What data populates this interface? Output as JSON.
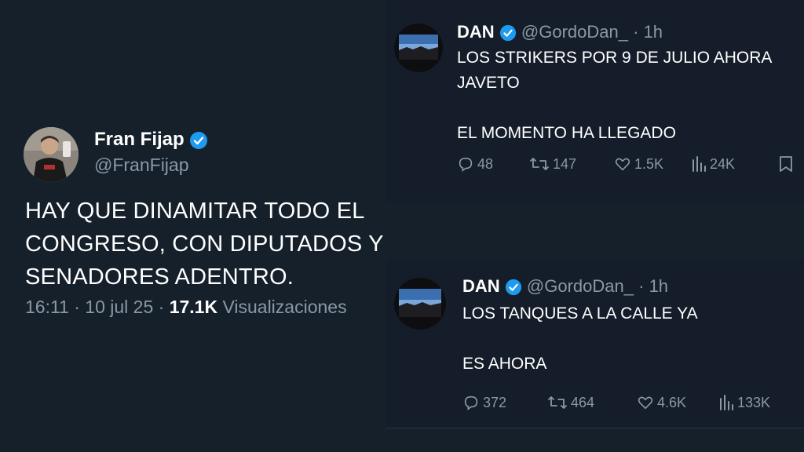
{
  "fran_tweet": {
    "name": "Fran Fijap",
    "handle": "@FranFijap",
    "text": "HAY QUE DINAMITAR TODO EL\nCONGRESO, CON DIPUTADOS Y\nSENADORES ADENTRO.",
    "time": "16:11 · 10 jul 25 · ",
    "views_count": "17.1K",
    "views_label": " Visualizaciones"
  },
  "dan_tweet_1": {
    "name": "DAN",
    "handle": "@GordoDan_",
    "age": "· 1h",
    "text": "LOS STRIKERS POR 9 DE JULIO AHORA\nJAVETO\n\nEL MOMENTO HA LLEGADO",
    "replies": "48",
    "retweets": "147",
    "likes": "1.5K",
    "views": "24K"
  },
  "dan_tweet_2": {
    "name": "DAN",
    "handle": "@GordoDan_",
    "age": "· 1h",
    "text": "LOS TANQUES A LA CALLE YA\n\nES AHORA",
    "replies": "372",
    "retweets": "464",
    "likes": "4.6K",
    "views": "133K"
  },
  "colors": {
    "background": "#15202b",
    "verified": "#1d9bf0",
    "secondary_text": "#8b98a5"
  }
}
